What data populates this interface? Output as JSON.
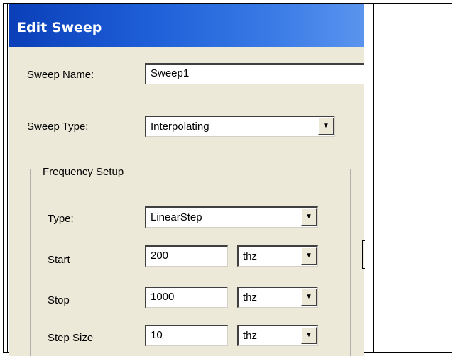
{
  "dialog": {
    "title": "Edit Sweep",
    "sweep_name": {
      "label": "Sweep Name:",
      "value": "Sweep1"
    },
    "sweep_type": {
      "label": "Sweep Type:",
      "value": "Interpolating"
    },
    "frequency_setup": {
      "legend": "Frequency Setup",
      "type": {
        "label": "Type:",
        "value": "LinearStep"
      },
      "start": {
        "label": "Start",
        "value": "200",
        "unit": "thz"
      },
      "stop": {
        "label": "Stop",
        "value": "1000",
        "unit": "thz"
      },
      "step_size": {
        "label": "Step Size",
        "value": "10",
        "unit": "thz"
      }
    }
  },
  "colors": {
    "titlebar": "#1e5fd8",
    "dialog_bg": "#ece9d8"
  },
  "icons": {
    "dropdown": "chevron-down-icon"
  }
}
